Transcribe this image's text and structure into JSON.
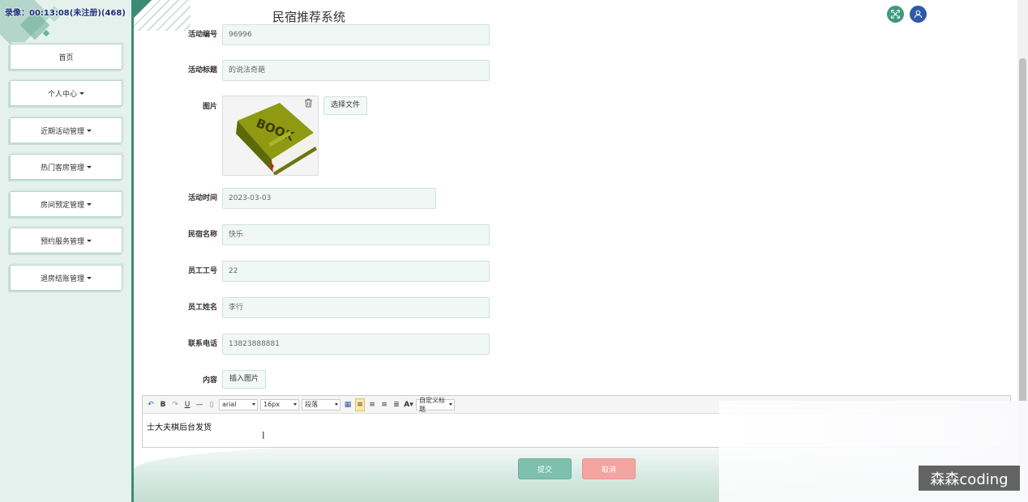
{
  "timer": "录像：00:13:08(未注册)(468)",
  "app_title": "民宿推荐系统",
  "sidebar": {
    "items": [
      {
        "label": "首页",
        "dropdown": false
      },
      {
        "label": "个人中心",
        "dropdown": true
      },
      {
        "label": "近期活动管理",
        "dropdown": true
      },
      {
        "label": "热门客房管理",
        "dropdown": true
      },
      {
        "label": "房间预定管理",
        "dropdown": true
      },
      {
        "label": "预约服务管理",
        "dropdown": true
      },
      {
        "label": "退房结账管理",
        "dropdown": true
      }
    ]
  },
  "header": {
    "fullscreen_icon": "fullscreen-icon",
    "user_icon": "user-icon"
  },
  "form": {
    "activity_no": {
      "label": "活动编号",
      "value": "96996"
    },
    "activity_title": {
      "label": "活动标题",
      "value": "的说法奇葩"
    },
    "image": {
      "label": "图片",
      "choose_file": "选择文件",
      "book_text": "BOOK"
    },
    "activity_time": {
      "label": "活动时间",
      "value": "2023-03-03"
    },
    "homestay_name": {
      "label": "民宿名称",
      "value": "快乐"
    },
    "staff_no": {
      "label": "员工工号",
      "value": "22"
    },
    "staff_name": {
      "label": "员工姓名",
      "value": "李行"
    },
    "phone": {
      "label": "联系电话",
      "value": "13823888881"
    },
    "content": {
      "label": "内容",
      "insert_image": "插入图片"
    }
  },
  "editor": {
    "font_family": "arial",
    "font_size": "16px",
    "paragraph": "段落",
    "custom_heading": "自定义标题",
    "body_text": "士大夫棋后台发货"
  },
  "actions": {
    "submit": "提交",
    "cancel": "取消"
  },
  "watermark": "森森coding",
  "colors": {
    "accent": "#3d8a73",
    "submit": "#7ec0ab",
    "cancel": "#f4a4a1",
    "user_btn": "#2e5aa6"
  }
}
